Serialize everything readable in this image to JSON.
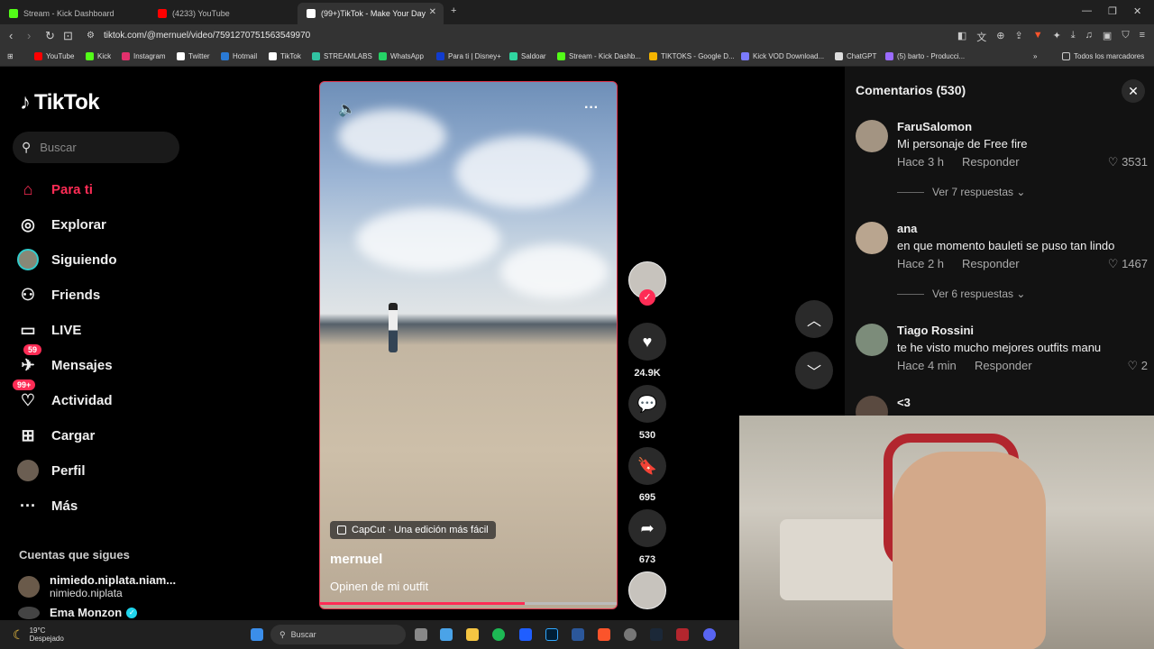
{
  "browser": {
    "tabs": [
      {
        "title": "Stream - Kick Dashboard",
        "color": "#53fc18"
      },
      {
        "title": "(4233) YouTube",
        "color": "#ff0000"
      },
      {
        "title": "(99+)TikTok - Make Your Day",
        "color": "#ffffff"
      }
    ],
    "url": "tiktok.com/@mernuel/video/7591270751563549970",
    "bookmarks": [
      {
        "label": "YouTube",
        "color": "#ff0000"
      },
      {
        "label": "Kick",
        "color": "#53fc18"
      },
      {
        "label": "Instagram",
        "color": "#e1306c"
      },
      {
        "label": "Twitter",
        "color": "#ffffff"
      },
      {
        "label": "Hotmail",
        "color": "#2a7ad5"
      },
      {
        "label": "TikTok",
        "color": "#ffffff"
      },
      {
        "label": "STREAMLABS",
        "color": "#31c3a2"
      },
      {
        "label": "WhatsApp",
        "color": "#25d366"
      },
      {
        "label": "Para ti | Disney+",
        "color": "#113ccf"
      },
      {
        "label": "Saldoar",
        "color": "#30d5a0"
      },
      {
        "label": "Stream - Kick Dashb...",
        "color": "#53fc18"
      },
      {
        "label": "TIKTOKS - Google D...",
        "color": "#f4b400"
      },
      {
        "label": "Kick VOD Download...",
        "color": "#7b7bff"
      },
      {
        "label": "ChatGPT",
        "color": "#dddddd"
      },
      {
        "label": "(5) barto - Producci...",
        "color": "#9b6bff"
      },
      {
        "label": "Todos los marcadores",
        "color": "#cccccc"
      }
    ]
  },
  "sidebar": {
    "brand": "TikTok",
    "search_placeholder": "Buscar",
    "nav": [
      {
        "label": "Para ti",
        "icon": "home-icon",
        "badge": ""
      },
      {
        "label": "Explorar",
        "icon": "compass-icon",
        "badge": ""
      },
      {
        "label": "Siguiendo",
        "icon": "avatar-icon",
        "badge": ""
      },
      {
        "label": "Friends",
        "icon": "friends-icon",
        "badge": ""
      },
      {
        "label": "LIVE",
        "icon": "live-icon",
        "badge": ""
      },
      {
        "label": "Mensajes",
        "icon": "messages-icon",
        "badge": "59"
      },
      {
        "label": "Actividad",
        "icon": "activity-icon",
        "badge": "99+"
      },
      {
        "label": "Cargar",
        "icon": "upload-icon",
        "badge": ""
      },
      {
        "label": "Perfil",
        "icon": "profile-icon",
        "badge": ""
      },
      {
        "label": "Más",
        "icon": "more-icon",
        "badge": ""
      }
    ],
    "following_title": "Cuentas que sigues",
    "following": [
      {
        "name": "nimiedo.niplata.niam...",
        "user": "nimiedo.niplata"
      },
      {
        "name": "Ema Monzon",
        "user": ""
      }
    ]
  },
  "video": {
    "capcut_label": "CapCut · Una edición más fácil",
    "author": "mernuel",
    "description": "Opinen de mi outfit",
    "progress": 0.69
  },
  "actions": {
    "likes": "24.9K",
    "comments": "530",
    "saves": "695",
    "shares": "673"
  },
  "comments": {
    "header": "Comentarios (530)",
    "items": [
      {
        "user": "FaruSalomon",
        "text": "Mi personaje de Free fire",
        "time": "Hace 3 h",
        "reply": "Responder",
        "likes": "3531",
        "more": "Ver 7 respuestas"
      },
      {
        "user": "ana",
        "text": "en que momento bauleti se puso tan lindo",
        "time": "Hace 2 h",
        "reply": "Responder",
        "likes": "1467",
        "more": "Ver 6 respuestas"
      },
      {
        "user": "Tiago Rossini",
        "text": "te he visto mucho mejores outfits manu",
        "time": "Hace 4 min",
        "reply": "Responder",
        "likes": "2",
        "more": ""
      },
      {
        "user": "<3",
        "text": "",
        "time": "",
        "reply": "",
        "likes": "",
        "more": ""
      }
    ]
  },
  "taskbar": {
    "temp": "19°C",
    "weather": "Despejado",
    "search": "Buscar"
  }
}
